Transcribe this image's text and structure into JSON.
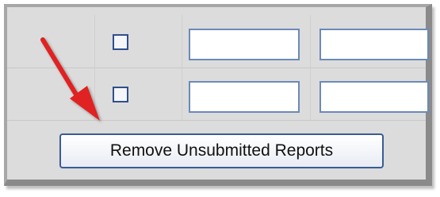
{
  "form": {
    "rows": [
      {
        "checkbox_checked": false,
        "field_a_value": "",
        "field_b_value": ""
      },
      {
        "checkbox_checked": false,
        "field_a_value": "",
        "field_b_value": ""
      }
    ],
    "remove_button_label": "Remove Unsubmitted Reports"
  },
  "annotation": {
    "arrow_icon": "red-arrow-pointing-icon",
    "arrow_color": "#e02020"
  },
  "colors": {
    "panel_bg": "#dcdcdc",
    "field_border": "#6b8ab8",
    "button_border": "#3a5c95"
  }
}
